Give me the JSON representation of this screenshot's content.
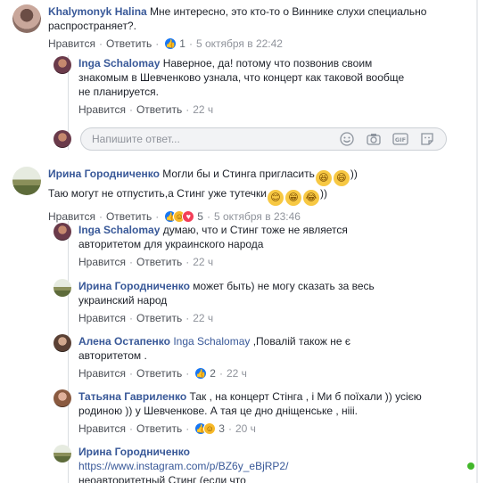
{
  "colors": {
    "link": "#385898",
    "like": "#1877f2",
    "online": "#42b72a"
  },
  "comments": [
    {
      "author": "Khalymonyk Halina",
      "text": "Мне интересно, это кто-то о Виннике слухи специально распространяет?.",
      "like": "Нравится",
      "reply": "Ответить",
      "reactions": "1",
      "time": "5 октября в 22:42"
    },
    {
      "author": "Inga Schalomay",
      "text": "Наверное, да! потому что позвонив своим знакомым в Шевченково узнала, что концерт как таковой вообще не планируется.",
      "like": "Нравится",
      "reply": "Ответить",
      "time": "22 ч"
    },
    {
      "author": "Ирина Городниченко",
      "text_line1": "Могли бы и Стинга пригласить",
      "text_line1_end": "))",
      "text_line2": "Таю могут не отпустить,а Стинг уже тутечки",
      "text_line2_end": "))",
      "like": "Нравится",
      "reply": "Ответить",
      "reactions": "5",
      "time": "5 октября в 23:46"
    },
    {
      "author": "Inga Schalomay",
      "text": "думаю, что и Стинг тоже не является авторитетом для украинского народа",
      "like": "Нравится",
      "reply": "Ответить",
      "time": "22 ч"
    },
    {
      "author": "Ирина Городниченко",
      "text": "может быть) не могу сказать за весь украинский народ",
      "like": "Нравится",
      "reply": "Ответить",
      "time": "22 ч"
    },
    {
      "author": "Алена Остапенко",
      "mention": "Inga Schalomay",
      "text": ",Повалій також не є авторитетом .",
      "like": "Нравится",
      "reply": "Ответить",
      "reactions": "2",
      "time": "22 ч"
    },
    {
      "author": "Татьяна Гавриленко",
      "text": "Так , на концерт Стінга , і Ми б поїхали )) усією родиною )) у Шевченкове. А тая це дно дніщенське , нііі.",
      "like": "Нравится",
      "reply": "Ответить",
      "reactions": "3",
      "time": "20 ч"
    },
    {
      "author": "Ирина Городниченко",
      "link": "https://www.instagram.com/p/BZ6y_eBjRP2/",
      "text_partial": "неоавторитетный Стинг (если что"
    }
  ],
  "reply_input": {
    "placeholder": "Напишите ответ..."
  },
  "icons": [
    "like-icon",
    "haha-icon",
    "heart-icon",
    "smiley-icon",
    "camera-icon",
    "gif-icon",
    "sticker-icon"
  ]
}
